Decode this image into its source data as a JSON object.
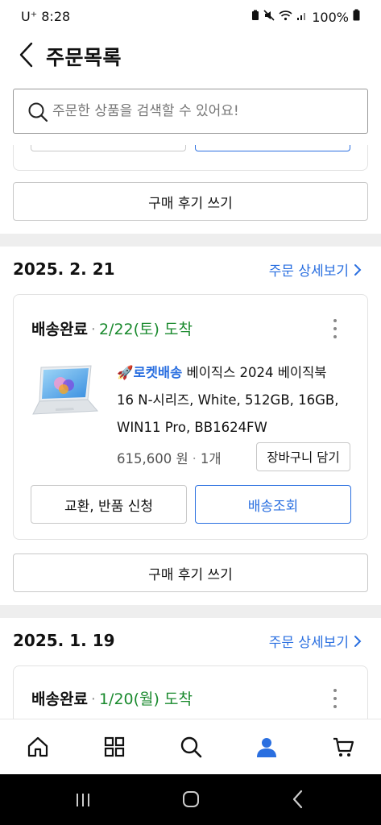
{
  "status_bar": {
    "carrier": "U⁺",
    "time": "8:28",
    "battery": "100%"
  },
  "header": {
    "title": "주문목록"
  },
  "search": {
    "placeholder": "주문한 상품을 검색할 수 있어요!"
  },
  "top_section": {
    "review_label": "구매 후기 쓰기"
  },
  "orders": [
    {
      "date": "2025. 2. 21",
      "detail_label": "주문 상세보기",
      "status": "배송완료",
      "arrival": "2/22(토) 도착",
      "badge": "로켓배송",
      "product_name": "베이직스 2024 베이직북 16 N-시리즈, White, 512GB, 16GB, WIN11 Pro, BB1624FW",
      "product_line1": "베이직스 2024 베이직북",
      "product_line2": "16 N-시리즈, White, 512GB, 16GB,",
      "product_line3": "WIN11 Pro, BB1624FW",
      "price": "615,600 원",
      "quantity": "1개",
      "cart_label": "장바구니 담기",
      "exchange_label": "교환, 반품 신청",
      "tracking_label": "배송조회",
      "review_label": "구매 후기 쓰기"
    },
    {
      "date": "2025. 1. 19",
      "detail_label": "주문 상세보기",
      "status": "배송완료",
      "arrival": "1/20(월) 도착"
    }
  ],
  "bottom_nav": {
    "items": [
      {
        "icon": "home-icon"
      },
      {
        "icon": "category-grid-icon"
      },
      {
        "icon": "search-icon"
      },
      {
        "icon": "user-icon",
        "active": true
      },
      {
        "icon": "cart-icon"
      }
    ]
  },
  "colors": {
    "accent": "#2a6fe0",
    "arrival_green": "#1a8a2e",
    "separator": "#eeeeee"
  }
}
